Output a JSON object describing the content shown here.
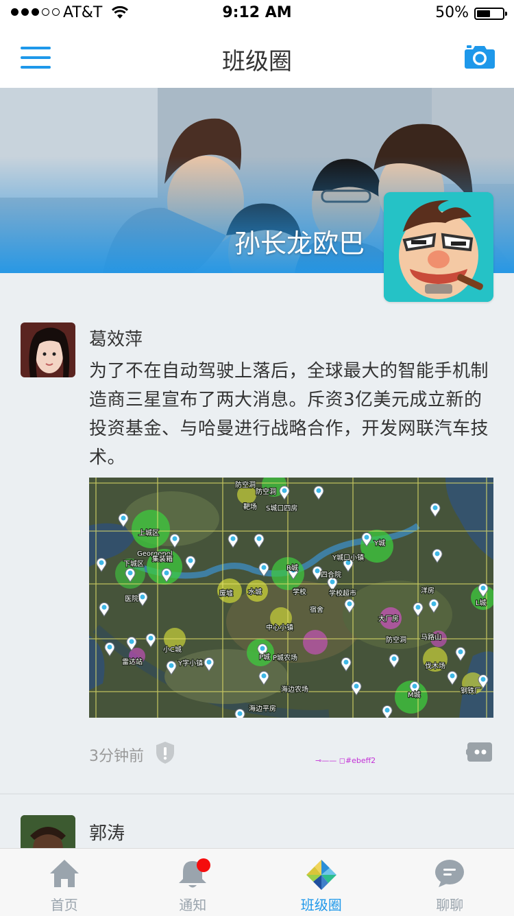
{
  "status_bar": {
    "carrier": "AT&T",
    "time": "9:12 AM",
    "battery": "50%",
    "battery_level": 0.5
  },
  "nav": {
    "title": "班级圈",
    "left_icon": "menu-icon",
    "right_icon": "camera-icon"
  },
  "profile": {
    "name": "孙长龙欧巴"
  },
  "post": {
    "author": "葛效萍",
    "content": "为了不在自动驾驶上落后，全球最大的智能手机制造商三星宣布了两大消息。斥资3亿美元成立新的投资基金、与哈曼进行战略合作，开发网联汽车技术。",
    "time": "3分钟前",
    "dev_note": "#ebeff2",
    "map_labels": [
      "防空洞",
      "防空洞",
      "靶场",
      "S城口四房",
      "上城区",
      "Georgopol",
      "集装箱",
      "下城区",
      "Y城口小镇",
      "Y城",
      "R城",
      "四合院",
      "废墟",
      "水城",
      "学校",
      "学校超市",
      "宿舍",
      "洋房",
      "医院",
      "L城",
      "大厂房",
      "中心小镇",
      "防空洞",
      "马路山",
      "小C城",
      "雷达站",
      "Y字小镇",
      "P城",
      "P城农场",
      "伐木场",
      "海边农场",
      "M城",
      "钢铁厂",
      "海边平房"
    ]
  },
  "post2": {
    "author": "郭涛"
  },
  "tabs": [
    {
      "label": "首页",
      "icon": "home-icon"
    },
    {
      "label": "通知",
      "icon": "bell-icon"
    },
    {
      "label": "班级圈",
      "icon": "pinwheel-icon"
    },
    {
      "label": "聊聊",
      "icon": "chat-bubble-icon"
    }
  ],
  "colors": {
    "accent": "#1e98ea",
    "background": "#ebeff2",
    "badge": "#f50d0d",
    "tab_inactive": "#9aa4ad"
  }
}
